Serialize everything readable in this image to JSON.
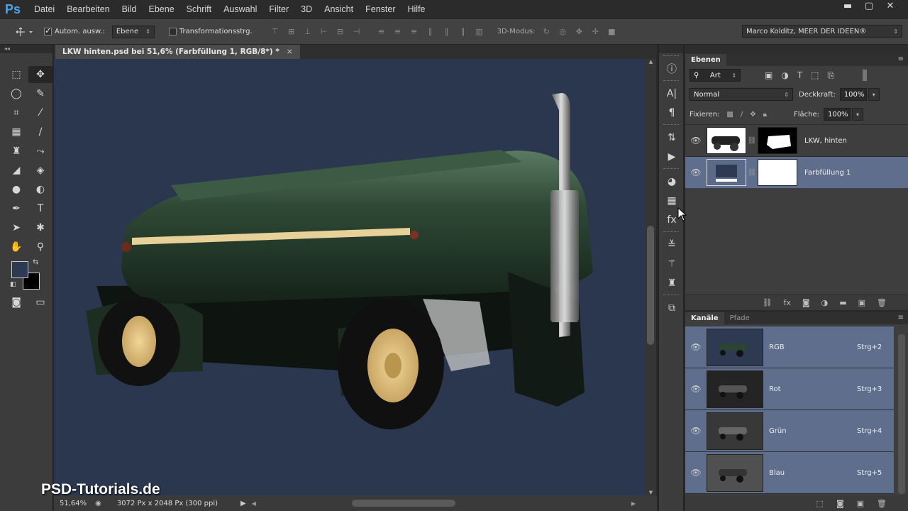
{
  "app": {
    "logo": "Ps"
  },
  "menu": [
    "Datei",
    "Bearbeiten",
    "Bild",
    "Ebene",
    "Schrift",
    "Auswahl",
    "Filter",
    "3D",
    "Ansicht",
    "Fenster",
    "Hilfe"
  ],
  "window_controls": {
    "minimize": "▬",
    "restore": "▢",
    "close": "✕"
  },
  "options": {
    "auto_select_label": "Autom. ausw.:",
    "auto_select_value": "Ebene",
    "transform_label": "Transformationsstrg.",
    "mode_3d_label": "3D-Modus:",
    "workspace": "Marco Kolditz, MEER DER IDEEN®"
  },
  "document": {
    "tab_title": "LKW hinten.psd bei 51,6% (Farbfüllung 1, RGB/8*) *",
    "close": "×",
    "zoom": "51,64%",
    "info": "3072 Px x 2048 Px (300 ppi)"
  },
  "watermark": "PSD-Tutorials.de",
  "colors": {
    "foreground": "#2d3a52",
    "background": "#000000",
    "canvas": "#2b374f",
    "selection": "#5e6e8c"
  },
  "layers_panel": {
    "tab": "Ebenen",
    "filter_kind": "Art",
    "blend_mode": "Normal",
    "opacity_label": "Deckkraft:",
    "opacity_value": "100%",
    "lock_label": "Fixieren:",
    "fill_label": "Fläche:",
    "fill_value": "100%",
    "layers": [
      {
        "name": "LKW, hinten",
        "selected": false
      },
      {
        "name": "Farbfüllung 1",
        "selected": true
      }
    ]
  },
  "channels_panel": {
    "tabs": [
      "Kanäle",
      "Pfade"
    ],
    "channels": [
      {
        "name": "RGB",
        "shortcut": "Strg+2"
      },
      {
        "name": "Rot",
        "shortcut": "Strg+3"
      },
      {
        "name": "Grün",
        "shortcut": "Strg+4"
      },
      {
        "name": "Blau",
        "shortcut": "Strg+5"
      }
    ]
  }
}
